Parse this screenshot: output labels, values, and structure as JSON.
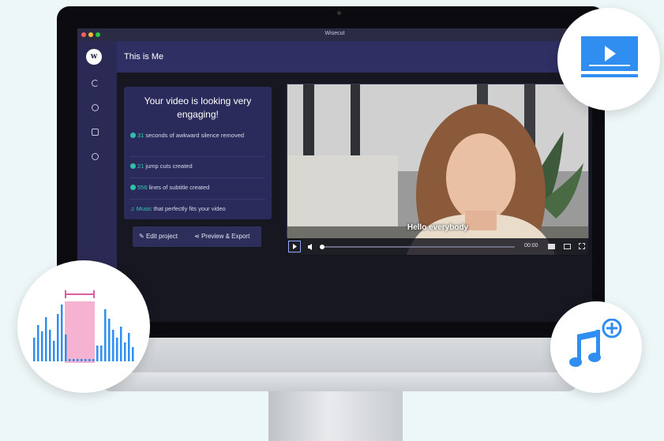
{
  "window": {
    "title": "Wisecut"
  },
  "brand": {
    "logo_letter": "w"
  },
  "header": {
    "title": "This is Me"
  },
  "summary": {
    "heading": "Your video is looking very engaging!",
    "items": [
      {
        "value": "31",
        "text": " seconds of awkward silence removed"
      },
      {
        "value": "21",
        "text": " jump cuts created"
      },
      {
        "value": "556",
        "text": " lines of subtitle created"
      },
      {
        "value": "Music",
        "text": " that perfectly fits your video"
      }
    ]
  },
  "actions": {
    "edit_label": "Edit project",
    "preview_label": "Preview & Export"
  },
  "video": {
    "subtitle": "Hello everybody",
    "time": "00:00",
    "progress": 0.0
  },
  "sidebar": {
    "icons": [
      "refresh-icon",
      "history-icon",
      "folder-icon",
      "help-icon"
    ]
  },
  "colors": {
    "accent": "#36c9b5",
    "sidebar": "#2a2a54",
    "header": "#2f2f63",
    "blue": "#2f8ef0",
    "pink": "#f5b3d1"
  }
}
